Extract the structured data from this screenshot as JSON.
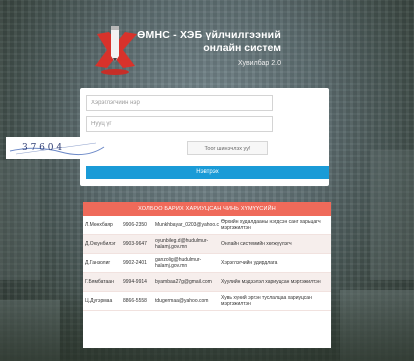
{
  "header": {
    "title_line1": "ӨМНС - ХЭБ үйлчилгээний",
    "title_line2": "онлайн систем",
    "version": "Хувилбар 2.0",
    "logo_icon": "pencil-x-logo-icon"
  },
  "login": {
    "username_placeholder": "Хэрэглэгчийн нэр",
    "password_placeholder": "Нууц үг",
    "captcha_text": "3 7 6 0 4",
    "refresh_label": "Тоог шинэчлэх уу!",
    "login_label": "Нэвтрэх"
  },
  "contacts": {
    "title": "ХОЛБОО БАРИХ ХАРИУЦСАН ЧИНЬ ХҮМҮҮСИЙН",
    "rows": [
      {
        "name": "Л.Мөнхбаяр",
        "phone": "9906-2350",
        "email": "Munkhbayar_0203@yahoo.com",
        "role": "Өрхийн худалдааны нэгдсэн санг харьцагч мэргэжилтэн"
      },
      {
        "name": "Д.Оюунбилэг",
        "phone": "9903-9647",
        "email": "oyunbileg.d@hudulmur-halamj.gov.mn",
        "role": "Онлайн системийн хөгжүүлэгч"
      },
      {
        "name": "Д.Ганзолиг",
        "phone": "9902-2401",
        "email": "ganzolig@hudulmur-halamj.gov.mn",
        "role": "Хэрэглэгчийн удирдлага"
      },
      {
        "name": "Г.Бямбатаан",
        "phone": "9994-9914",
        "email": "byambaa27g@gmail.com",
        "role": "Хуулийн мэдээлэл хариуцсан мэргэжилтэн"
      },
      {
        "name": "Ц.Дугэрмаа",
        "phone": "8866-5558",
        "email": "tdugermaa@yahoo.com",
        "role": "Хувь хүний эргэн туслалцаа хариуцсан мэргэжилтэн"
      }
    ]
  }
}
